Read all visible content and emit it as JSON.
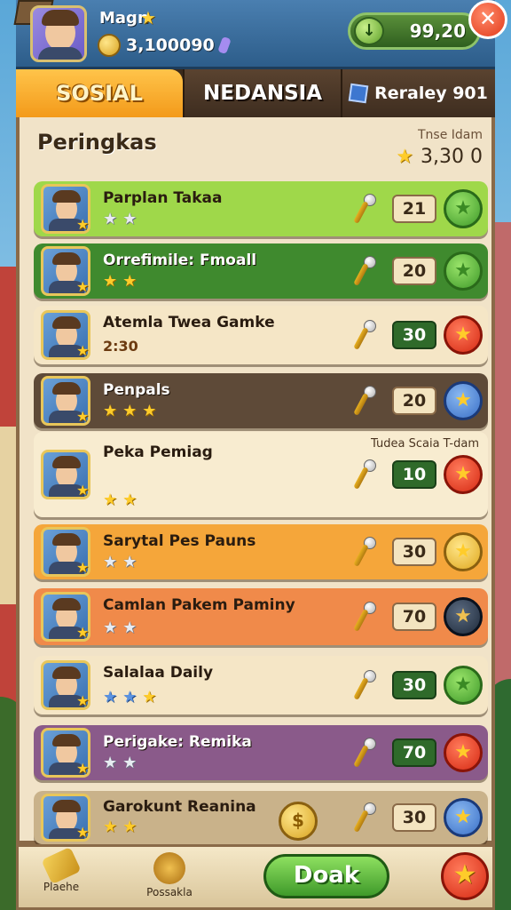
{
  "header": {
    "player_name": "Magn",
    "coins": "3,100090",
    "energy": "99,20",
    "close_glyph": "✕",
    "energy_glyph": "↓"
  },
  "tabs": [
    {
      "label": "SOSIAL",
      "active": true
    },
    {
      "label": "NEDANSIA",
      "active": false
    },
    {
      "label": "Reraley 901",
      "active": false
    }
  ],
  "panel": {
    "title": "Peringkas",
    "subtitle": "Tnse Idam",
    "score": "3,30  0"
  },
  "rows": [
    {
      "name": "Parplan Takaa",
      "stars": [
        "silver",
        "silver"
      ],
      "extra": "",
      "score": "21",
      "score_style": "light",
      "medal": "green",
      "bg": "#9fd84a"
    },
    {
      "name": "Orrefimile: Fmoall",
      "stars": [
        "gold",
        "gold"
      ],
      "extra": "",
      "score": "20",
      "score_style": "light",
      "medal": "green",
      "bg": "#3f8a2e"
    },
    {
      "name": "Atemla Twea Gamke",
      "stars": [],
      "extra": "2:30",
      "score": "30",
      "score_style": "green",
      "medal": "red",
      "bg": "#f5e6c6"
    },
    {
      "name": "Penpals",
      "stars": [
        "gold",
        "gold",
        "gold"
      ],
      "extra": "",
      "score": "20",
      "score_style": "light",
      "medal": "blue",
      "bg": "#5e4a38"
    },
    {
      "name": "Peka Pemiag",
      "stars": [
        "gold",
        "gold"
      ],
      "extra": "Tudea Scaia T-dam",
      "score": "10",
      "score_style": "green",
      "medal": "red",
      "bg": "#f8ecd0"
    },
    {
      "name": "Sarytal Pes Pauns",
      "stars": [
        "silver",
        "silver"
      ],
      "extra": "",
      "score": "30",
      "score_style": "light",
      "medal": "gold",
      "bg": "#f5a63a"
    },
    {
      "name": "Camlan Pakem Paminy",
      "stars": [
        "silver",
        "silver"
      ],
      "extra": "",
      "score": "70",
      "score_style": "light",
      "medal": "dark",
      "bg": "#f08a4a"
    },
    {
      "name": "Salalaa Daily",
      "stars": [
        "blue",
        "blue",
        "gold"
      ],
      "extra": "",
      "score": "30",
      "score_style": "green",
      "medal": "green",
      "bg": "#f5e6c6"
    },
    {
      "name": "Perigake: Remika",
      "stars": [
        "silver",
        "silver"
      ],
      "extra": "",
      "score": "70",
      "score_style": "green",
      "medal": "red",
      "bg": "#8a5a8a"
    },
    {
      "name": "Garokunt Reanina",
      "stars": [
        "gold",
        "gold"
      ],
      "extra": "",
      "score": "30",
      "score_style": "light",
      "medal": "blue",
      "bg": "#c9b28a"
    }
  ],
  "bottom": {
    "nav1": "Plaehe",
    "nav2": "Possakla",
    "primary_button": "Doak",
    "fav_glyph": "★"
  },
  "colors": {
    "accent_orange": "#f39a1a",
    "header_blue": "#2d5d8a",
    "panel_bg": "#f1e3c8"
  },
  "icons": {
    "row_tool": "microphone-icon",
    "coin": "coin-icon",
    "energy": "energy-icon"
  }
}
